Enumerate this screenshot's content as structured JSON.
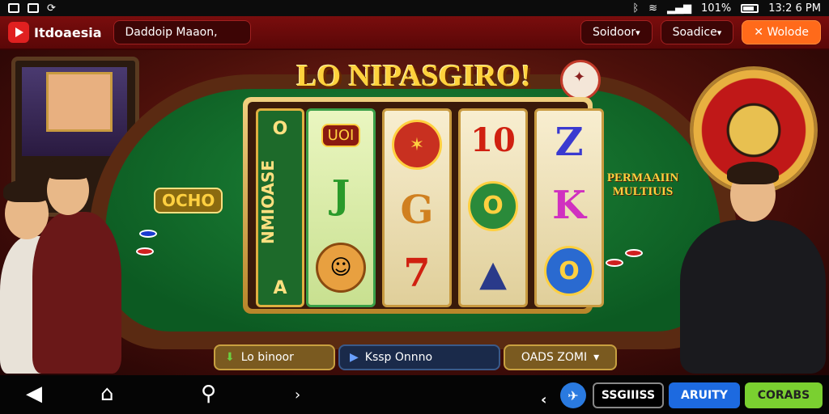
{
  "status_bar": {
    "battery_text": "101%",
    "time": "13:2 6 PM"
  },
  "app_bar": {
    "brand": "Itdoaesia",
    "search_label": "Daddoip Maaon,",
    "dropdown_1": "Soidoor",
    "dropdown_2": "Soadice",
    "action_button": "Wolode"
  },
  "game": {
    "title": "LO NIPASGIRO!",
    "side_reel": {
      "top": "O",
      "vertical": "NMIOASE",
      "bottom": "A"
    },
    "left_badge": "OCHO",
    "right_banner": "PERMAAIIN MULTIUIS",
    "reels": [
      [
        "UOI",
        "J",
        "face"
      ],
      [
        "disc",
        "G",
        "7"
      ],
      [
        "10",
        "O",
        "pyramid"
      ],
      [
        "Z",
        "K",
        "O"
      ]
    ]
  },
  "bottom_buttons": {
    "btn_1": "Lo binoor",
    "btn_2": "Kssp Onnno",
    "btn_3": "OADS ZOMI"
  },
  "nav_bar": {
    "btn_1": "SSGIIISS",
    "btn_2": "ARUITY",
    "btn_3": "CORABS"
  },
  "colors": {
    "app_bar": "#7a0d0d",
    "felt": "#0c5a22",
    "accent_orange": "#ff6a1a",
    "nav_blue": "#1d6ae0",
    "nav_green": "#7ad030"
  }
}
